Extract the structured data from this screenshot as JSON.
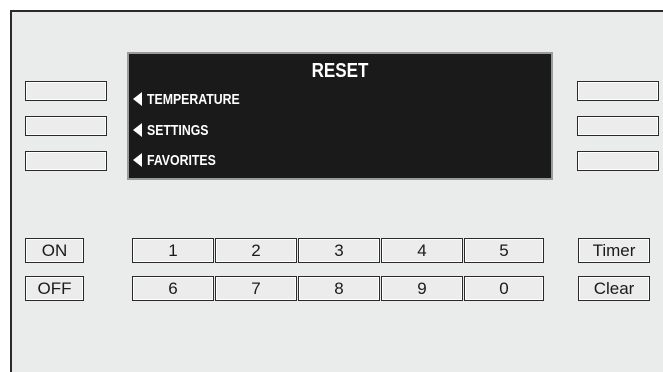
{
  "display": {
    "title": "RESET",
    "menu_items": [
      {
        "label": "TEMPERATURE"
      },
      {
        "label": "SETTINGS"
      },
      {
        "label": "FAVORITES"
      }
    ]
  },
  "power": {
    "on_label": "ON",
    "off_label": "OFF"
  },
  "keypad": {
    "row1": [
      "1",
      "2",
      "3",
      "4",
      "5"
    ],
    "row2": [
      "6",
      "7",
      "8",
      "9",
      "0"
    ]
  },
  "side": {
    "timer_label": "Timer",
    "clear_label": "Clear"
  },
  "colors": {
    "panel": "#eaebeb",
    "display_bg": "#1a1a1a",
    "display_text": "#ffffff",
    "key_border": "#2a2a2a"
  }
}
